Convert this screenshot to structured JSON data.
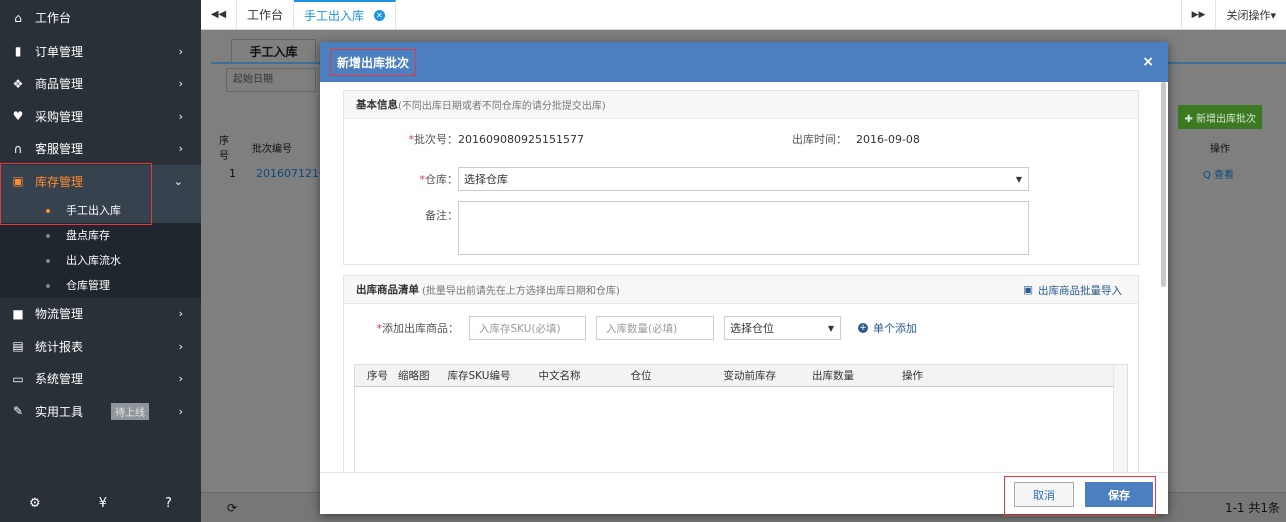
{
  "sidebar": {
    "home": {
      "icon": "home-icon",
      "label": "工作台"
    },
    "items": [
      {
        "icon": "clipboard-icon",
        "label": "订单管理",
        "arrow": "›"
      },
      {
        "icon": "product-icon",
        "label": "商品管理",
        "arrow": "›"
      },
      {
        "icon": "cart-icon",
        "label": "采购管理",
        "arrow": "›"
      },
      {
        "icon": "headset-icon",
        "label": "客服管理",
        "arrow": "›"
      },
      {
        "icon": "inventory-icon",
        "label": "库存管理",
        "arrow": "⌄"
      }
    ],
    "sub_items": [
      {
        "label": "手工出入库"
      },
      {
        "label": "盘点库存"
      },
      {
        "label": "出入库流水"
      },
      {
        "label": "仓库管理"
      }
    ],
    "items2": [
      {
        "icon": "truck-icon",
        "label": "物流管理",
        "arrow": "›"
      },
      {
        "icon": "report-icon",
        "label": "统计报表",
        "arrow": "›"
      },
      {
        "icon": "monitor-icon",
        "label": "系统管理",
        "arrow": "›"
      },
      {
        "icon": "wrench-icon",
        "label": "实用工具",
        "badge": "待上线",
        "arrow": "›"
      }
    ],
    "footer": [
      "settings-icon",
      "yen-icon",
      "help-icon"
    ]
  },
  "tabs": {
    "back_icon": "◀◀",
    "items": [
      {
        "label": "工作台"
      },
      {
        "label": "手工出入库"
      }
    ],
    "forward_icon": "▶▶",
    "close_ops": "关闭操作▾"
  },
  "page": {
    "tab_label": "手工入库",
    "date_placeholder": "起始日期",
    "new_batch_button": "✚ 新增出库批次",
    "headers": {
      "seq": "序号",
      "batch_no": "批次编号",
      "ops": "操作"
    },
    "row": {
      "seq": "1",
      "batch_no": "2016071210",
      "op": "Q 查看"
    },
    "footer": {
      "refresh": "⟳",
      "pager": "1-1  共1条"
    }
  },
  "modal": {
    "title": "新增出库批次",
    "close": "×",
    "basic": {
      "title": "基本信息",
      "note": "(不同出库日期或者不同仓库的请分批提交出库)",
      "batch_label": "批次号：",
      "batch_value": "201609080925151577",
      "time_label": "出库时间：",
      "time_value": "2016-09-08",
      "warehouse_label": "仓库：",
      "warehouse_value": "选择仓库",
      "remark_label": "备注："
    },
    "goods": {
      "title": "出库商品清单",
      "note": "(批量导出前请先在上方选择出库日期和仓库)",
      "import": "出库商品批量导入",
      "add_label": "添加出库商品：",
      "sku_placeholder": "入库存SKU(必填)",
      "qty_placeholder": "入库数量(必填)",
      "location_value": "选择仓位",
      "single_add": "单个添加",
      "columns": [
        "序号",
        "缩略图",
        "库存SKU编号",
        "中文名称",
        "仓位",
        "变动前库存",
        "出库数量",
        "操作"
      ]
    },
    "cancel": "取消",
    "save": "保存"
  }
}
